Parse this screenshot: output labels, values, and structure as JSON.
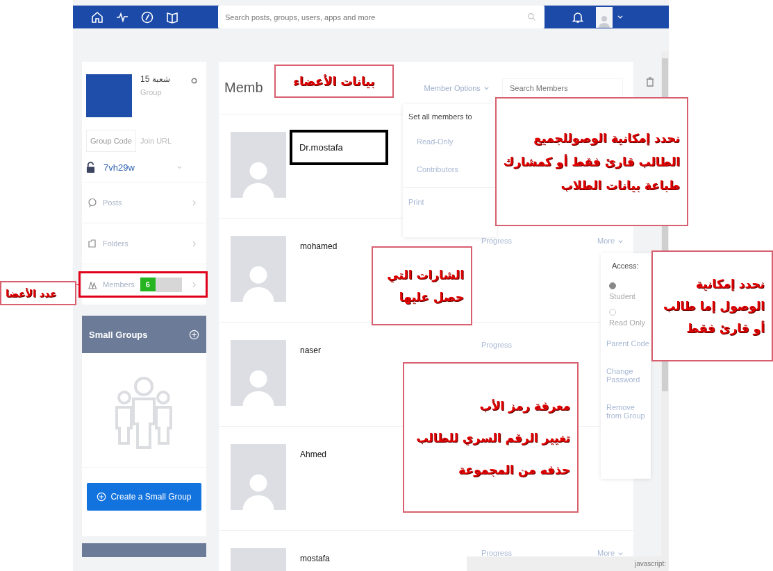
{
  "topbar": {
    "search": {
      "placeholder": "Search posts, groups, users, apps and more"
    }
  },
  "group": {
    "title": "شعبة 15",
    "subtitle": "Group",
    "tabs": [
      {
        "label": "Group Code",
        "selected": true
      },
      {
        "label": "Join URL",
        "selected": false
      }
    ],
    "code": "7vh29w",
    "nav": [
      {
        "label": "Posts",
        "kind": "posts"
      },
      {
        "label": "Folders",
        "kind": "folders"
      },
      {
        "label": "Members",
        "kind": "members",
        "badge": "6"
      }
    ]
  },
  "small_groups": {
    "title": "Small Groups",
    "button": "Create a Small Group"
  },
  "members": {
    "title": "Memb",
    "options": "Member Options",
    "search": {
      "placeholder": "Search Members"
    },
    "rows": [
      {
        "name": "Dr.mostafa",
        "highlighted": true
      },
      {
        "name": "mohamed",
        "highlighted": false,
        "progress": "Progress",
        "more": "More"
      },
      {
        "name": "naser",
        "highlighted": false,
        "progress": "Progress"
      },
      {
        "name": "Ahmed",
        "highlighted": false
      },
      {
        "name": "mostafa",
        "highlighted": false,
        "progress": "Progress",
        "more": "More"
      }
    ]
  },
  "options_menu": {
    "heading": "Set all members to",
    "items": [
      "Read-Only",
      "Contributors"
    ],
    "print": "Print"
  },
  "more_menu": {
    "heading": "Access:",
    "access": [
      {
        "label": "Student",
        "selected": true
      },
      {
        "label": "Read Only",
        "selected": false
      }
    ],
    "items": [
      "Parent Code",
      "Change Password",
      "Remove from Group"
    ]
  },
  "status_bar": "javascript:",
  "callouts": [
    {
      "kind": "title",
      "lines": [
        "بيانات الأعضاء"
      ]
    },
    {
      "kind": "options",
      "lines": [
        "نحدد إمكانية الوصوللجميع",
        "الطالب قارئ فقط أو كمشارك",
        "طباعة بيانات الطلاب"
      ]
    },
    {
      "kind": "badges",
      "lines": [
        "الشارات التي",
        "حصل عليها"
      ]
    },
    {
      "kind": "access",
      "lines": [
        "نحدد إمكانية",
        "الوصول إما طالب",
        "أو قارئ فقط"
      ]
    },
    {
      "kind": "actions",
      "lines": [
        "معرفة رمز الأب",
        "تغيير الرقم السري للطالب",
        "حذفه من المجموعة"
      ]
    },
    {
      "kind": "count",
      "lines": [
        "عدد الأعضا"
      ]
    }
  ]
}
